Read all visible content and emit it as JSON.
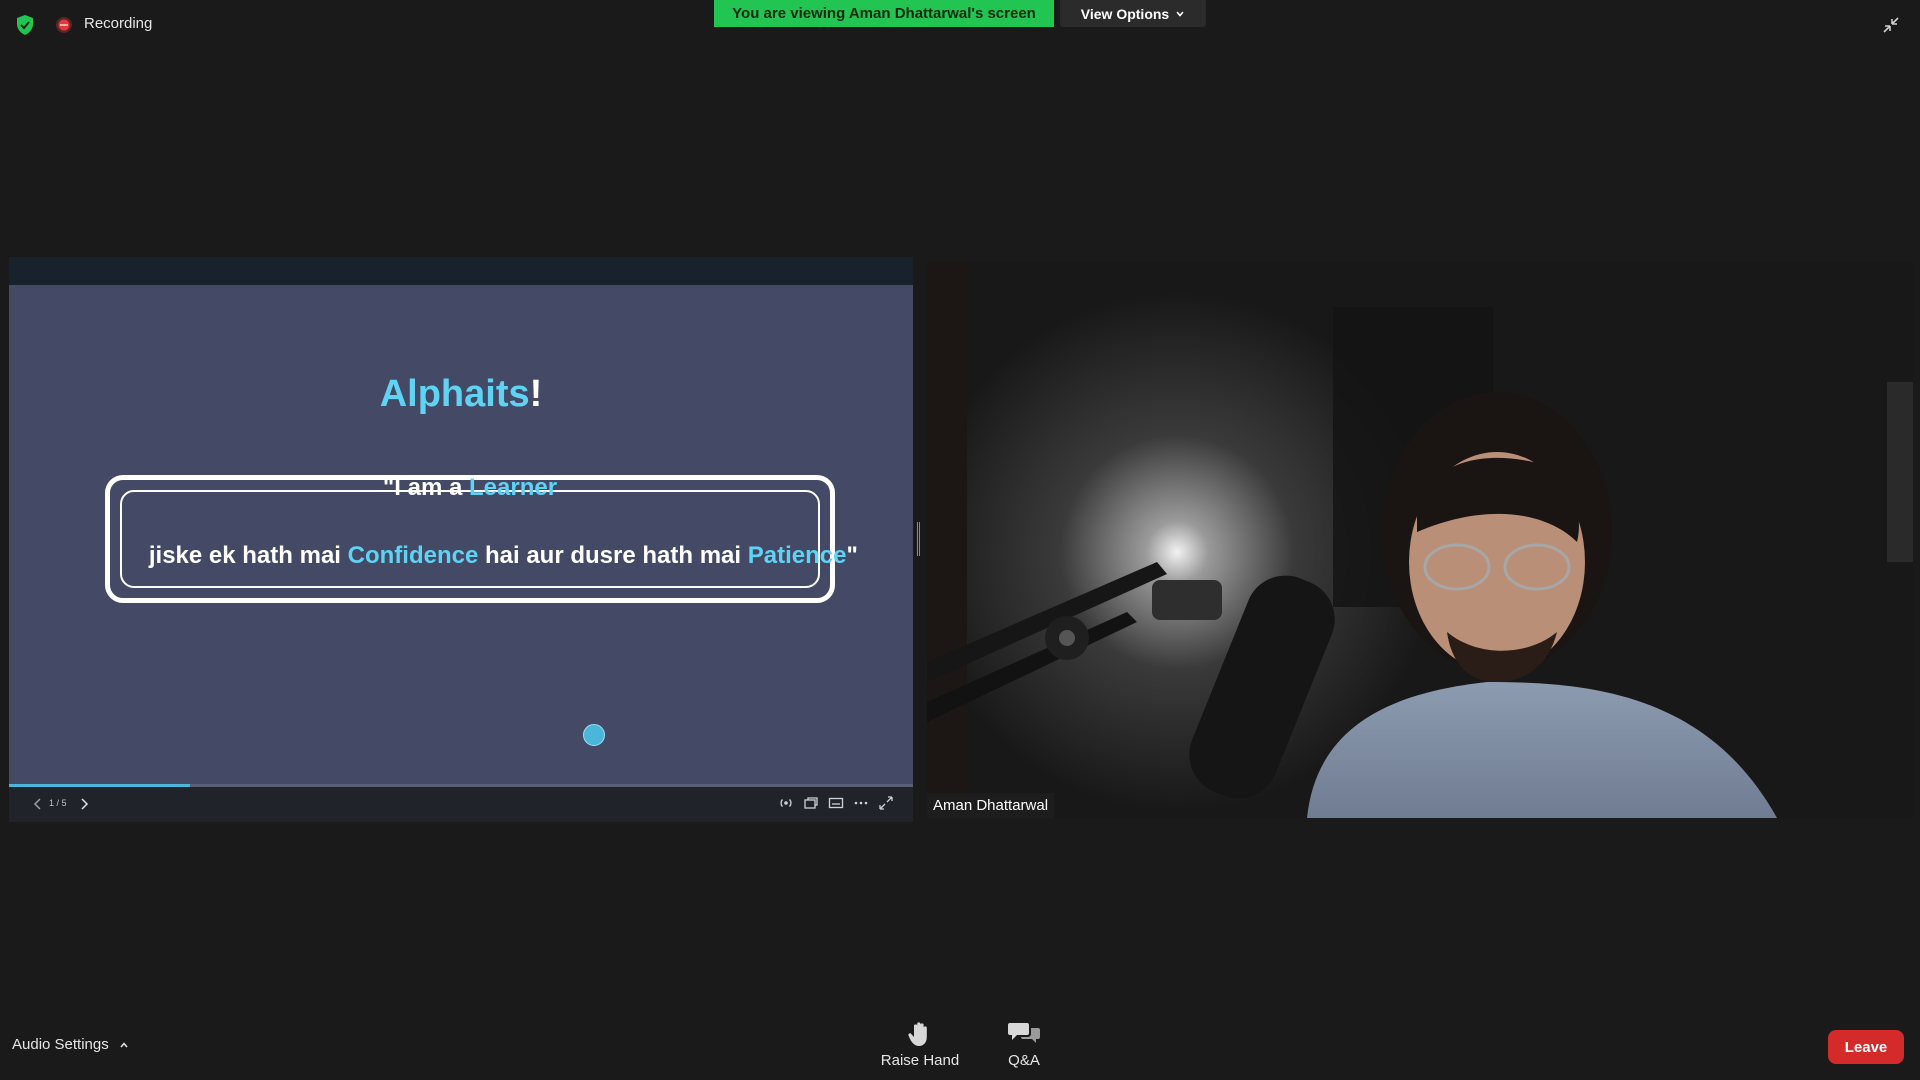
{
  "top_bar": {
    "recording_label": "Recording",
    "banner_text": "You are viewing Aman Dhattarwal's screen",
    "view_options_label": "View Options",
    "colors": {
      "banner": "#23c552",
      "recording": "#e03a3a",
      "shield": "#23c552"
    }
  },
  "slide": {
    "title_main": "Alphaits",
    "title_punct": "!",
    "quote": {
      "line1_a": "\"I am a ",
      "line1_b": "Learner",
      "line2_a": "jiske ek hath mai ",
      "line2_b": "Confidence",
      "line2_c": " hai aur dusre hath mai ",
      "line2_d": "Patience",
      "line2_e": "\""
    },
    "counter": "1 / 5",
    "progress_fraction": 0.2,
    "colors": {
      "background": "#444a66",
      "accent": "#5fd3f3"
    }
  },
  "video": {
    "participant_name": "Aman Dhattarwal"
  },
  "bottom_bar": {
    "audio_settings_label": "Audio Settings",
    "raise_hand_label": "Raise Hand",
    "qa_label": "Q&A",
    "leave_label": "Leave",
    "colors": {
      "leave": "#d42a2a"
    }
  },
  "icons": [
    "shield-icon",
    "record-icon",
    "chevron-down-icon",
    "exit-fullscreen-icon",
    "chevron-left-icon",
    "chevron-right-icon",
    "broadcast-icon",
    "window-icon",
    "captions-icon",
    "more-icon",
    "expand-icon",
    "chevron-up-icon",
    "hand-icon",
    "qa-icon"
  ]
}
